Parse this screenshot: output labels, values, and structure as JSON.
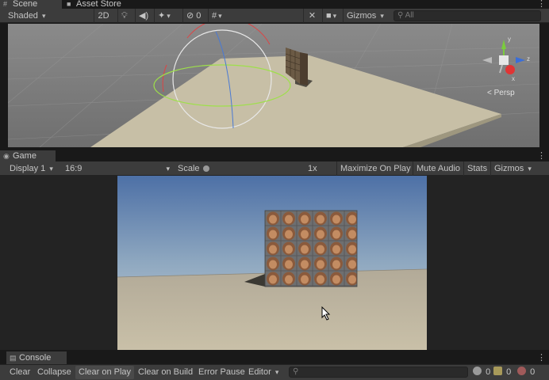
{
  "scene_tabs": {
    "scene": "Scene",
    "asset_store": "Asset Store"
  },
  "scene_toolbar": {
    "shading": "Shaded",
    "mode_2d": "2D",
    "hidden_count": "0",
    "gizmos": "Gizmos",
    "search_placeholder": "All",
    "persp_label": "Persp"
  },
  "game_tab": {
    "label": "Game"
  },
  "game_toolbar": {
    "display": "Display 1",
    "aspect": "16:9",
    "scale_label": "Scale",
    "scale_value": "1x",
    "maximize": "Maximize On Play",
    "mute": "Mute Audio",
    "stats": "Stats",
    "gizmos": "Gizmos"
  },
  "console_tab": {
    "label": "Console"
  },
  "console_toolbar": {
    "clear": "Clear",
    "collapse": "Collapse",
    "clear_on_play": "Clear on Play",
    "clear_on_build": "Clear on Build",
    "error_pause": "Error Pause",
    "editor": "Editor",
    "log_count": "0",
    "warning_count": "0",
    "error_count": "0"
  },
  "colors": {
    "editor_bg": "#3c3c3c",
    "dark_bg": "#191919",
    "ground": "#c7bfa6",
    "sky_top": "#4d70a6",
    "sky_bottom": "#b8c8d4",
    "grid_bg": "#7f7f7f"
  }
}
